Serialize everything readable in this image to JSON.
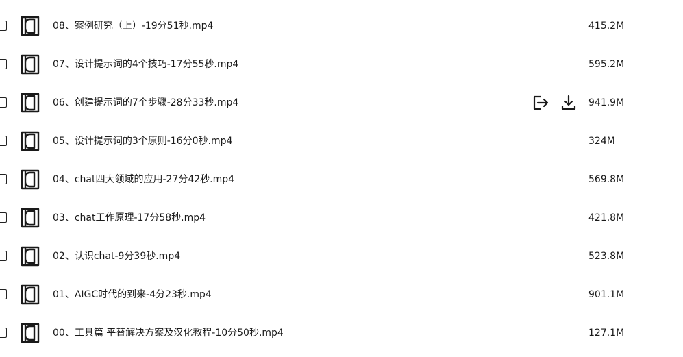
{
  "file_list": {
    "files": [
      {
        "name": "08、案例研究（上）-19分51秒.mp4",
        "size": "415.2M",
        "hovered": false
      },
      {
        "name": "07、设计提示词的4个技巧-17分55秒.mp4",
        "size": "595.2M",
        "hovered": false
      },
      {
        "name": "06、创建提示词的7个步骤-28分33秒.mp4",
        "size": "941.9M",
        "hovered": true
      },
      {
        "name": "05、设计提示词的3个原则-16分0秒.mp4",
        "size": "324M",
        "hovered": false
      },
      {
        "name": "04、chat四大领域的应用-27分42秒.mp4",
        "size": "569.8M",
        "hovered": false
      },
      {
        "name": "03、chat工作原理-17分58秒.mp4",
        "size": "421.8M",
        "hovered": false
      },
      {
        "name": "02、认识chat-9分39秒.mp4",
        "size": "523.8M",
        "hovered": false
      },
      {
        "name": "01、AIGC时代的到来-4分23秒.mp4",
        "size": "901.1M",
        "hovered": false
      },
      {
        "name": "00、工具篇 平替解决方案及汉化教程-10分50秒.mp4",
        "size": "127.1M",
        "hovered": false
      }
    ],
    "icons": {
      "file": "video-file-icon",
      "share": "share-icon",
      "download": "download-icon"
    },
    "colors": {
      "text": "#1a1a1a",
      "icon": "#1a1a1a",
      "background": "#ffffff"
    }
  }
}
